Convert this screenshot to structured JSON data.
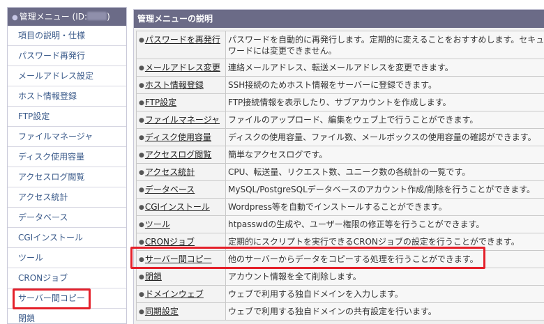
{
  "sidebar": {
    "header": "管理メニュー (ID:",
    "header_close": ")",
    "items": [
      {
        "label": "項目の説明・仕様"
      },
      {
        "label": "パスワード再発行"
      },
      {
        "label": "メールアドレス設定"
      },
      {
        "label": "ホスト情報登録"
      },
      {
        "label": "FTP設定"
      },
      {
        "label": "ファイルマネージャ"
      },
      {
        "label": "ディスク使用容量"
      },
      {
        "label": "アクセスログ閲覧"
      },
      {
        "label": "アクセス統計"
      },
      {
        "label": "データベース"
      },
      {
        "label": "CGIインストール"
      },
      {
        "label": "ツール"
      },
      {
        "label": "CRONジョブ"
      },
      {
        "label": "サーバー間コピー"
      },
      {
        "label": "閉鎖"
      }
    ]
  },
  "main": {
    "header": "管理メニューの説明",
    "rows": [
      {
        "name": "パスワードを再発行",
        "desc": "パスワードを自動的に再発行します。定期的に変えることをおすすめします。セキュ ワードには変更できません。"
      },
      {
        "name": "メールアドレス変更",
        "desc": "連絡メールアドレス、転送メールアドレスを変更できます。"
      },
      {
        "name": "ホスト情報登録",
        "desc": "SSH接続のためホスト情報をサーバーに登録できます。"
      },
      {
        "name": "FTP設定",
        "desc": "FTP接続情報を表示したり、サブアカウントを作成します。"
      },
      {
        "name": "ファイルマネージャ",
        "desc": "ファイルのアップロード、編集をウェブ上で行うことができます。"
      },
      {
        "name": "ディスク使用容量",
        "desc": "ディスクの使用容量、ファイル数、メールボックスの使用容量の確認ができます。"
      },
      {
        "name": "アクセスログ閲覧",
        "desc": "簡単なアクセスログです。"
      },
      {
        "name": "アクセス統計",
        "desc": "CPU、転送量、リクエスト数、ユニーク数の各統計の一覧です。"
      },
      {
        "name": "データベース",
        "desc": "MySQL/PostgreSQLデータベースのアカウント作成/削除を行うことができます。"
      },
      {
        "name": "CGIインストール",
        "desc": "Wordpress等を自動でインストールすることができます。"
      },
      {
        "name": "ツール",
        "desc": "htpasswdの生成や、ユーザー権限の修正等を行うことができます。"
      },
      {
        "name": "CRONジョブ",
        "desc": "定期的にスクリプトを実行できるCRONジョブの設定を行うことができます。"
      },
      {
        "name": "サーバー間コピー",
        "desc": "他のサーバーからデータをコピーする処理を行うことができます。"
      },
      {
        "name": "閉鎖",
        "desc": "アカウント情報を全て削除します。"
      },
      {
        "name": "ドメインウェブ",
        "desc": "ウェブで利用する独自ドメインを入力します。"
      },
      {
        "name": "同期設定",
        "desc": "ウェブで利用する独自ドメインの共有設定を行います。"
      }
    ]
  },
  "colors": {
    "header_bg": "#6b6b87",
    "highlight": "#e4202a",
    "link": "#3a5a8a"
  }
}
